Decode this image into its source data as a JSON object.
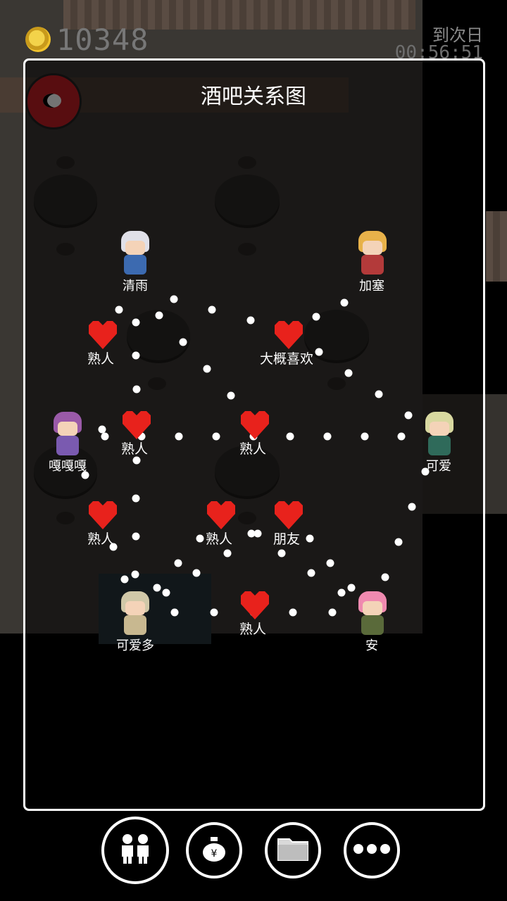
{
  "hud": {
    "coins": "10348",
    "next_day_label": "到次日",
    "timer": "00:56:51"
  },
  "panel": {
    "title": "酒吧关系图"
  },
  "characters": [
    {
      "name": "清雨",
      "hair": "#e0e0e8",
      "body": "#3c6ab0"
    },
    {
      "name": "加塞",
      "hair": "#e8b24a",
      "body": "#b33a3a"
    },
    {
      "name": "可爱",
      "hair": "#d8d8a0",
      "body": "#2f6a5a"
    },
    {
      "name": "嘎嘎嘎",
      "hair": "#9a5aa8",
      "body": "#7a5ab0"
    },
    {
      "name": "可爱多",
      "hair": "#d0c8a8",
      "body": "#c8b890"
    },
    {
      "name": "安",
      "hair": "#f08ab0",
      "body": "#5a6a3a"
    }
  ],
  "relations": [
    {
      "label": "熟人"
    },
    {
      "label": "大概喜欢"
    },
    {
      "label": "熟人"
    },
    {
      "label": "熟人"
    },
    {
      "label": "熟人"
    },
    {
      "label": "熟人"
    },
    {
      "label": "朋友"
    },
    {
      "label": "熟人"
    }
  ],
  "colors": {
    "heart": "#e8221c",
    "panel_border": "#ffffff"
  },
  "buttons": [
    {
      "icon": "people-icon"
    },
    {
      "icon": "money-bag-icon"
    },
    {
      "icon": "folder-icon"
    },
    {
      "icon": "more-icon"
    }
  ]
}
